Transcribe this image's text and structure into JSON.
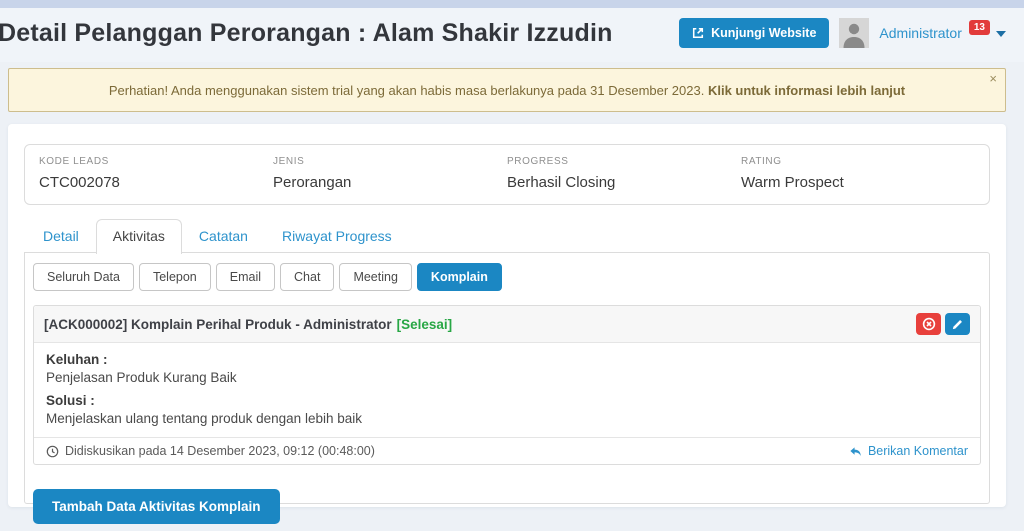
{
  "header": {
    "title": "Detail Pelanggan Perorangan : Alam Shakir Izzudin",
    "visit_button": "Kunjungi Website",
    "user_name": "Administrator",
    "notification_count": "13"
  },
  "alert": {
    "text": "Perhatian! Anda menggunakan sistem trial yang akan habis masa berlakunya pada 31 Desember 2023. ",
    "link": "Klik untuk informasi lebih lanjut",
    "close_icon": "×"
  },
  "summary": {
    "fields": [
      {
        "label": "KODE LEADS",
        "value": "CTC002078"
      },
      {
        "label": "JENIS",
        "value": "Perorangan"
      },
      {
        "label": "PROGRESS",
        "value": "Berhasil Closing"
      },
      {
        "label": "RATING",
        "value": "Warm Prospect"
      }
    ]
  },
  "tabs": [
    {
      "label": "Detail",
      "active": false
    },
    {
      "label": "Aktivitas",
      "active": true
    },
    {
      "label": "Catatan",
      "active": false
    },
    {
      "label": "Riwayat Progress",
      "active": false
    }
  ],
  "filters": [
    {
      "label": "Seluruh Data",
      "active": false
    },
    {
      "label": "Telepon",
      "active": false
    },
    {
      "label": "Email",
      "active": false
    },
    {
      "label": "Chat",
      "active": false
    },
    {
      "label": "Meeting",
      "active": false
    },
    {
      "label": "Komplain",
      "active": true
    }
  ],
  "complaint": {
    "title": "[ACK000002] Komplain Perihal Produk - Administrator",
    "status": "[Selesai]",
    "keluhan_label": "Keluhan :",
    "keluhan_text": "Penjelasan Produk Kurang Baik",
    "solusi_label": "Solusi :",
    "solusi_text": "Menjelaskan ulang tentang produk dengan lebih baik",
    "discussed": "Didiskusikan pada 14 Desember 2023, 09:12 (00:48:00)",
    "comment_link": "Berikan Komentar"
  },
  "add_button": "Tambah Data Aktivitas Komplain",
  "colors": {
    "accent": "#1b87c3",
    "link": "#2e93cc",
    "danger": "#e8403c",
    "badge": "#e23b3b",
    "success": "#28a745",
    "warning_bg": "#fcf5dd",
    "warning_border": "#cdbd8d",
    "warning_text": "#7c6a38"
  }
}
